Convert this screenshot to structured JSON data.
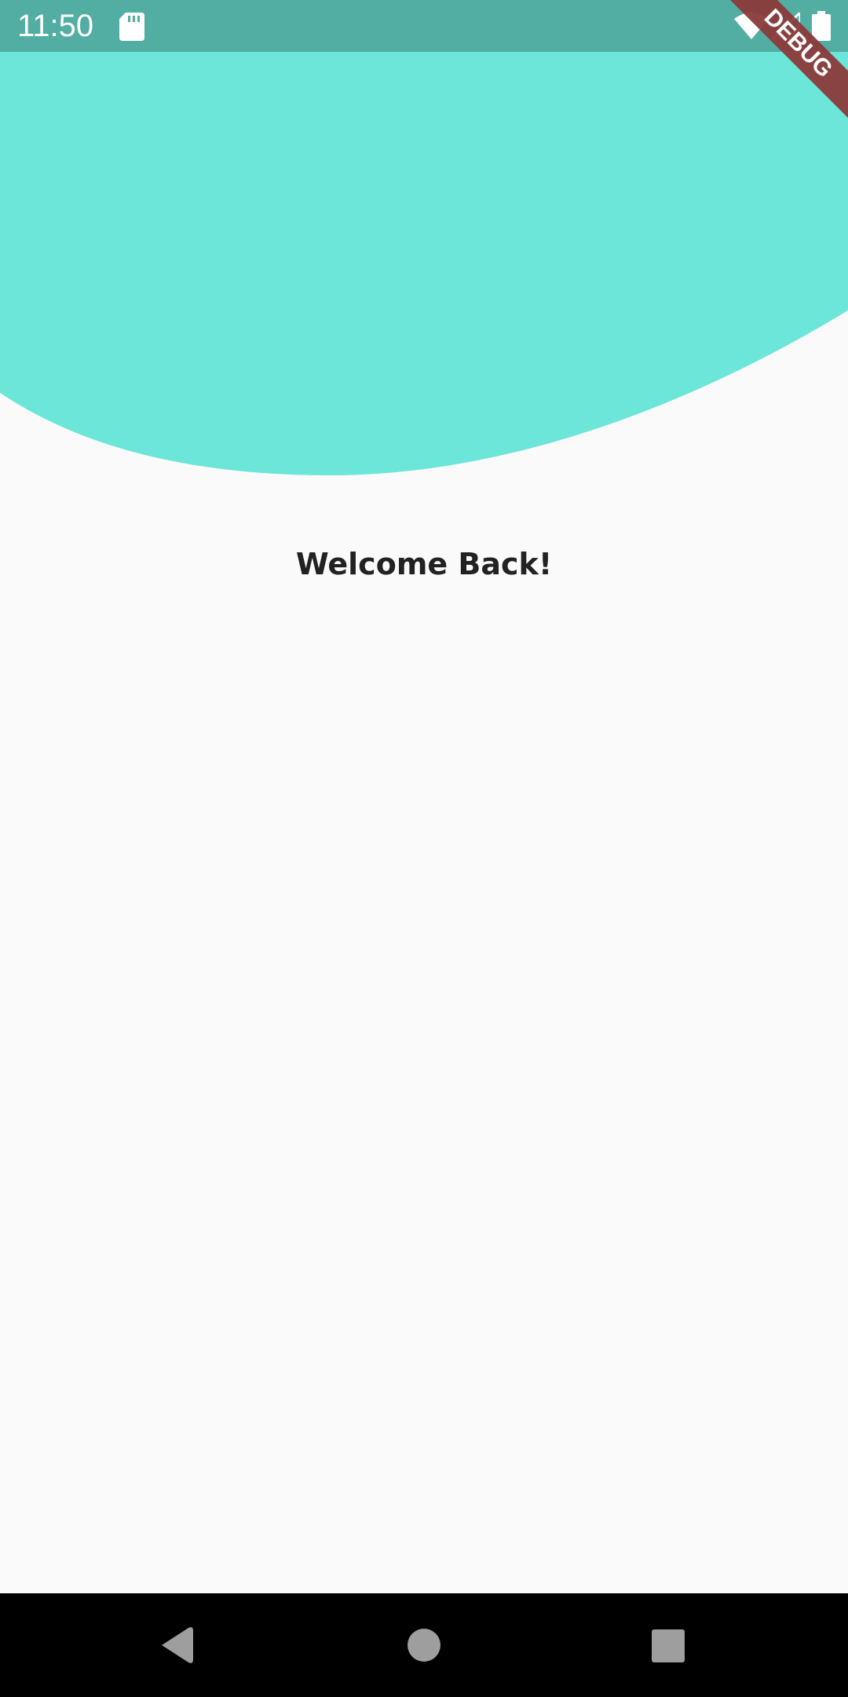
{
  "status_bar": {
    "time": "11:50",
    "background_color": "#52ada2",
    "icons": [
      "sd-card-icon",
      "wifi-icon",
      "cellular-signal-icon",
      "battery-icon"
    ]
  },
  "header": {
    "wave_color": "#6ce6d8"
  },
  "debug_banner": {
    "label": "DEBUG",
    "color": "#8b3a3a"
  },
  "main": {
    "title": "Welcome Back!"
  },
  "navigation_bar": {
    "buttons": [
      "back-button",
      "home-button",
      "recents-button"
    ],
    "icon_color": "#9e9e9e"
  }
}
